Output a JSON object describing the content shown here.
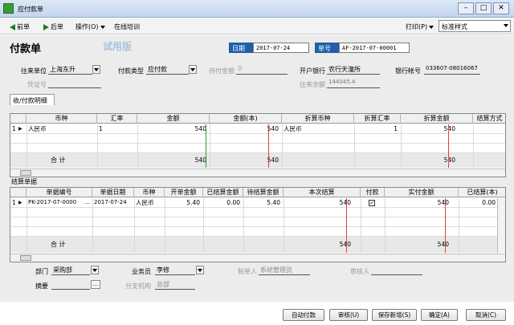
{
  "window": {
    "title": "应付款单",
    "min": "–",
    "max": "□",
    "close": "✕"
  },
  "toolbar": {
    "prev": "前单",
    "next": "后单",
    "ops": "操作(O)",
    "training": "在线培训",
    "print": "打印(P)",
    "style_value": "标准样式"
  },
  "form": {
    "title": "付款单",
    "watermark": "试用版",
    "date_label": "日期",
    "date_value": "2017-07-24",
    "no_label": "单号",
    "no_value": "AF-2017-07-00001",
    "partner_label": "往来单位",
    "partner_value": "上海东升",
    "paytype_label": "付款类型",
    "paytype_value": "应付款",
    "prepaid_label": "待付金额",
    "prepaid_value": "0",
    "bank_label": "开户银行",
    "bank_value": "农行天潼所",
    "account_label": "银行帐号",
    "account_value": "033607-08016067",
    "voucher_label": "凭证号",
    "balance_label": "往来余额",
    "balance_value": "144045.4"
  },
  "tab": {
    "label": "收/付款明细"
  },
  "grid1": {
    "headers": [
      "币种",
      "汇率",
      "金额",
      "金额(本)",
      "折算币种",
      "折算汇率",
      "折算金额",
      "结算方式"
    ],
    "row": {
      "num": "1",
      "currency": "人民币",
      "rate": "1",
      "amount": "540",
      "amount_local": "540",
      "conv_currency": "人民币",
      "conv_rate": "1",
      "conv_amount": "540"
    },
    "total_label": "合 计",
    "total_amount": "540",
    "total_local": "540",
    "total_conv": "540"
  },
  "settle_label": "结算单据",
  "grid2": {
    "headers": [
      "单据编号",
      "单据日期",
      "币种",
      "开单金额",
      "已结算金额",
      "待结算金额",
      "本次结算",
      "付款",
      "实付金额",
      "已结算(本)"
    ],
    "row": {
      "num": "1",
      "docno": "PK-2017-07-0000",
      "date": "2017-07-24",
      "currency": "人民币",
      "open": "5.40",
      "settled": "0.00",
      "pending": "5.40",
      "current": "540",
      "paid": "540",
      "settled_local": "0.00"
    },
    "total_label": "合 计",
    "total_current": "540",
    "total_paid": "540"
  },
  "footer": {
    "dept_label": "部门",
    "dept_value": "采购部",
    "staff_label": "业务员",
    "staff_value": "李修",
    "maker_label": "制单人",
    "maker_value": "系统管理员",
    "auditor_label": "审核人",
    "memo_label": "摘要",
    "branch_label": "分支机构",
    "branch_value": "总部"
  },
  "buttons": {
    "auto": "自动付款",
    "audit": "审核(U)",
    "save_new": "保存新增(S)",
    "ok": "确定(A)",
    "cancel": "取消(C)"
  }
}
